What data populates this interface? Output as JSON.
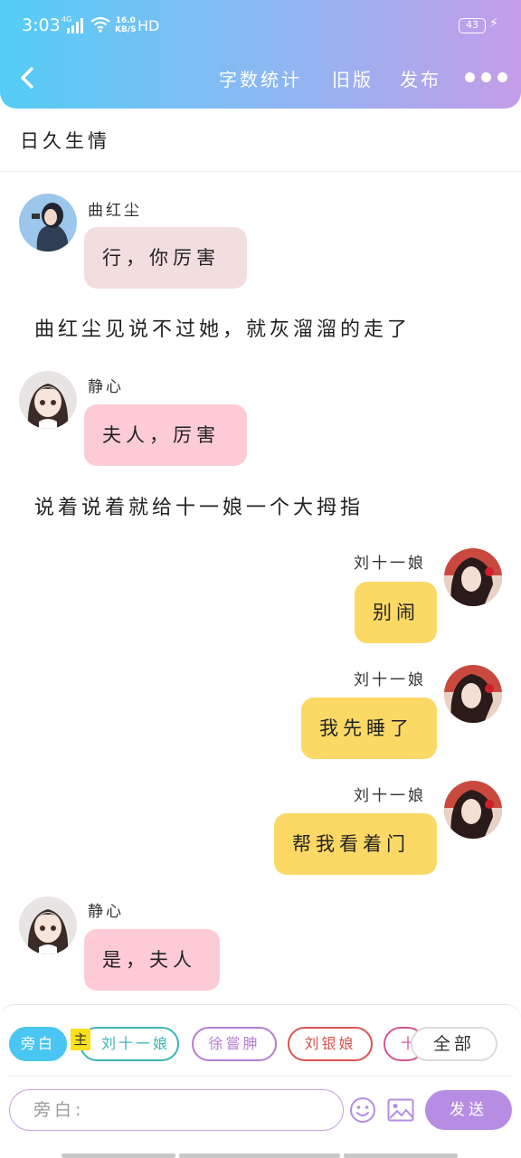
{
  "status_bar": {
    "time": "3:03",
    "network": "4G",
    "speed_value": "16.0",
    "speed_unit": "KB/S",
    "hd": "HD",
    "battery": "43"
  },
  "nav": {
    "word_count": "字数统计",
    "old_version": "旧版",
    "publish": "发布"
  },
  "story_title": "日久生情",
  "messages": [
    {
      "type": "char",
      "side": "left",
      "name": "曲红尘",
      "text": "行，你厉害",
      "bubble_color": "#f3dedf"
    },
    {
      "type": "narration",
      "text": "曲红尘见说不过她，就灰溜溜的走了"
    },
    {
      "type": "char",
      "side": "left",
      "name": "静心",
      "text": "夫人，厉害",
      "bubble_color": "#fdcbd6"
    },
    {
      "type": "narration",
      "text": "说着说着就给十一娘一个大拇指"
    },
    {
      "type": "char",
      "side": "right",
      "name": "刘十一娘",
      "text": "别闹",
      "bubble_color": "#fcd865"
    },
    {
      "type": "char",
      "side": "right",
      "name": "刘十一娘",
      "text": "我先睡了",
      "bubble_color": "#fcd865"
    },
    {
      "type": "char",
      "side": "right",
      "name": "刘十一娘",
      "text": "帮我看着门",
      "bubble_color": "#fcd865"
    },
    {
      "type": "char",
      "side": "left",
      "name": "静心",
      "text": "是，夫人",
      "bubble_color": "#fdcbd6"
    }
  ],
  "roles": [
    {
      "label": "旁白",
      "color": "#49c6f2",
      "selected": true
    },
    {
      "label": "刘十一娘",
      "color": "#3ab6b6",
      "badge": "主"
    },
    {
      "label": "徐嘗胂",
      "color": "#b67ed4"
    },
    {
      "label": "刘银娘",
      "color": "#d8554f"
    },
    {
      "label": "十",
      "color": "#d45694"
    }
  ],
  "all_button": "全部",
  "composer": {
    "placeholder": "旁白:",
    "send": "发送"
  },
  "colors": {
    "header_start": "#54cdf6",
    "header_end": "#c49ce9",
    "send": "#b68de2"
  },
  "icons": [
    "back-arrow-icon",
    "more-dots-icon",
    "emoji-icon",
    "image-icon",
    "wifi-icon",
    "signal-icon",
    "battery-icon"
  ]
}
